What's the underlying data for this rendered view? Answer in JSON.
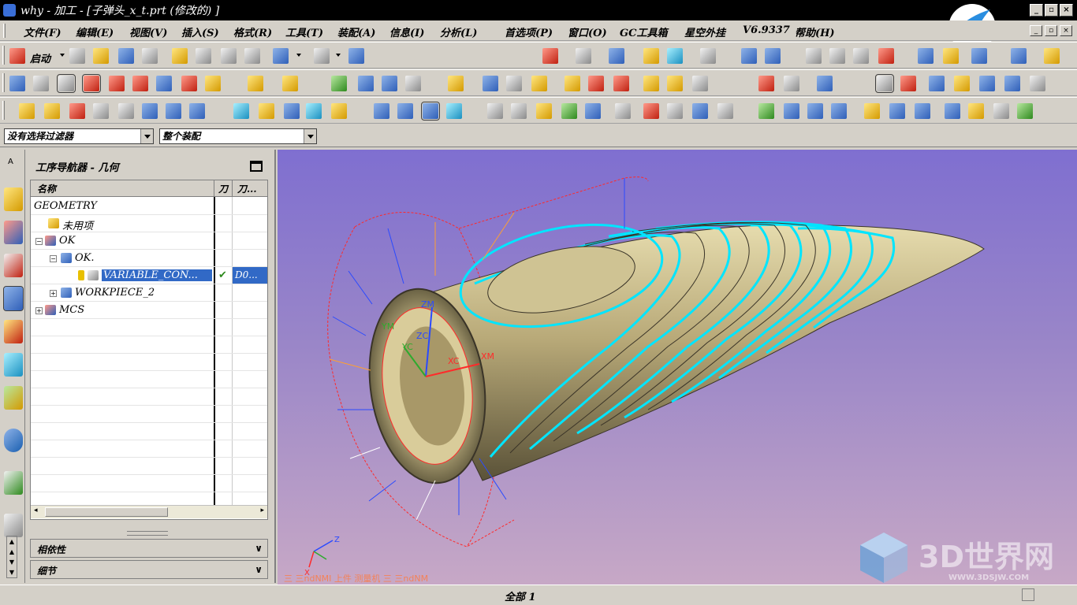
{
  "window": {
    "title": "why - 加工 - [子弹头_x_t.prt  (修改的) ]"
  },
  "menu": {
    "items": [
      "文件(F)",
      "编辑(E)",
      "视图(V)",
      "插入(S)",
      "格式(R)",
      "工具(T)",
      "装配(A)",
      "信息(I)",
      "分析(L)",
      "首选项(P)",
      "窗口(O)",
      "GC工具箱",
      "星空外挂",
      "V6.9337",
      "帮助(H)"
    ]
  },
  "toolbar": {
    "start_label": "启动"
  },
  "selection_bar": {
    "filter_value": "没有选择过滤器",
    "scope_value": "整个装配"
  },
  "navigator": {
    "title": "工序导航器 - 几何",
    "columns": [
      "名称",
      "刀",
      "刀..."
    ],
    "rows": [
      {
        "label": "GEOMETRY",
        "level": 0
      },
      {
        "label": "未用项",
        "level": 1
      },
      {
        "label": "OK",
        "level": 1
      },
      {
        "label": "OK.",
        "level": 2
      },
      {
        "label": "VARIABLE_CON...",
        "level": 3,
        "selected": true,
        "status": "✔",
        "tool": "D0..."
      },
      {
        "label": "WORKPIECE_2",
        "level": 2
      },
      {
        "label": "MCS",
        "level": 1
      }
    ],
    "panels": [
      "相依性",
      "细节"
    ]
  },
  "viewport": {
    "axis_labels": {
      "zm": "ZM",
      "zc": "ZC",
      "ym": "YM",
      "yc": "YC",
      "xc": "XC",
      "xm": "XM",
      "tz": "Z",
      "tx": "X"
    },
    "status_hint": "三 三ndNMI 上件 测量机 三 三ndNM",
    "watermark": "3D世界网",
    "watermark_url": "WWW.3DSJW.COM",
    "accent_cyan": "#00e5ff",
    "body_color": "#b8a978"
  },
  "status": {
    "text": "全部 1"
  }
}
